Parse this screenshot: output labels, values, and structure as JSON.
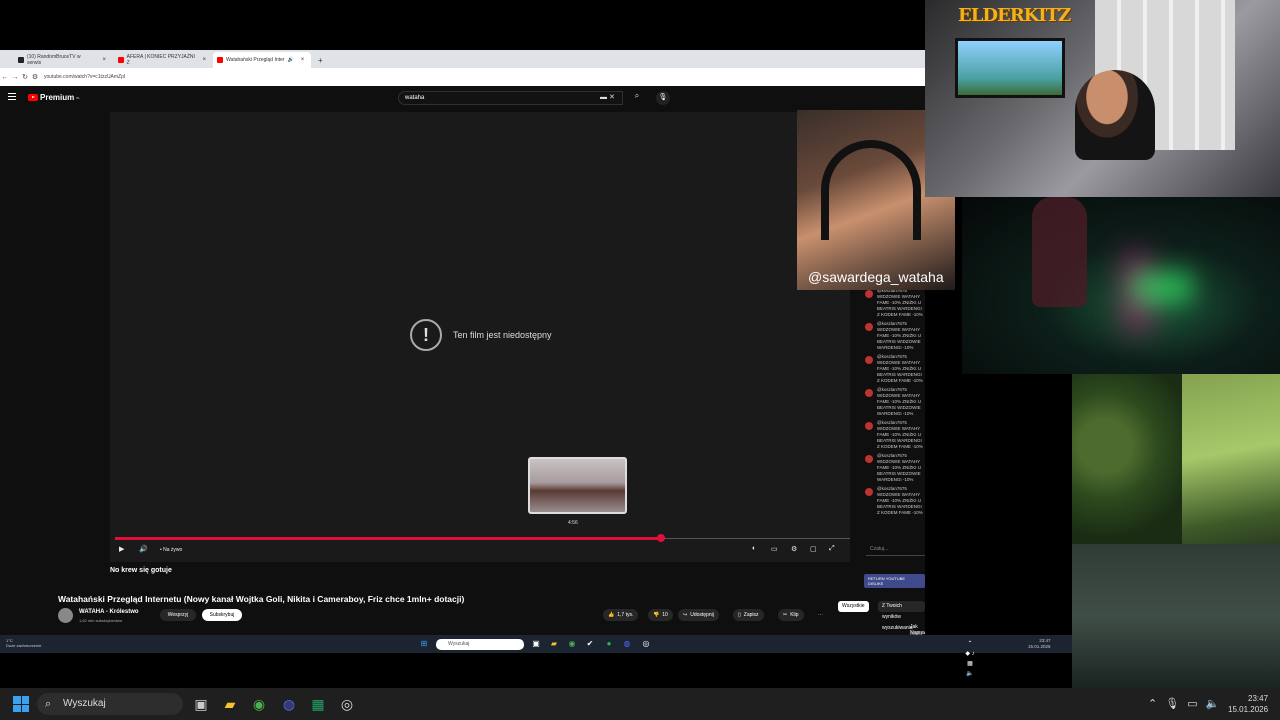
{
  "browser": {
    "tabs": [
      {
        "label": "(10) RandomBruceTV w serwis",
        "icon": "x-logo-icon",
        "color": "#222222"
      },
      {
        "label": "AFERA | KONIEC PRZYJAŹNI Z",
        "icon": "youtube-icon",
        "color": "#ff0000"
      },
      {
        "label": "Watahański Przegląd Inter",
        "icon": "youtube-icon",
        "color": "#ff0000",
        "active": true
      }
    ],
    "url": "youtube.com/watch?v=c1tzzUAmZpI"
  },
  "youtube": {
    "logo_text": "Premium",
    "logo_sup": "PL",
    "search_value": "wataha",
    "player": {
      "error_text": "Ten film jest niedostępny",
      "hover_time": "4:56",
      "live_label": "• Na żywo",
      "progress": 0.79
    },
    "live_title": "No krew się gotuje",
    "chat": {
      "messages": [
        "@koszlan7675 WIDZOWIE WATAHY FAME -10% ZNIŻKI U BEATRIS WARDENGI Z KODEM FAME -10%",
        "@koszlan7675 WIDZOWIE WATAHY FAME -10% ZNIŻKI U BEATRIS WIDZOWIE WARDENGI -10%",
        "@koszlan7675 WIDZOWIE WATAHY FAME -10% ZNIŻKI U BEATRIS WARDENGI Z KODEM FAME -10%",
        "@koszlan7675 WIDZOWIE WATAHY FAME -10% ZNIŻKI U BEATRIS WIDZOWIE WARDENGI -10%",
        "@koszlan7675 WIDZOWIE WATAHY FAME -10% ZNIŻKI U BEATRIS WARDENGI Z KODEM FAME -10%",
        "@koszlan7675 WIDZOWIE WATAHY FAME -10% ZNIŻKI U BEATRIS WIDZOWIE WARDENGI -10%",
        "@koszlan7675 WIDZOWIE WATAHY FAME -10% ZNIŻKI U BEATRIS WARDENGI Z KODEM FAME -10%"
      ],
      "input_placeholder": "Czatuj...",
      "return_button": "RETURN YOUTUBE DISLIKE"
    },
    "video": {
      "title": "Watahański Przegląd Internetu (Nowy kanał Wojtka Goli, Nikita i Cameraboy, Friz chce 1mln+ dotacji)",
      "channel": "WATAHA - Królestwo",
      "subscribers": "1,62 mln subskrybentów",
      "support_label": "Wesprzyj",
      "subscribe_label": "Subskrybuj",
      "likes": "1,7 tys.",
      "dislikes": "10",
      "share_label": "Udostępnij",
      "save_label": "Zapisz",
      "clip_label": "Klip",
      "more_label": "⋯"
    },
    "filter_chips": [
      "Wszystkie",
      "Z Twoich wyników wyszukiwania"
    ],
    "recommendation_title": "Jak Naprawdę Działa Polska",
    "recommendation_sub": "Mafia Sharestopowych"
  },
  "inner_taskbar": {
    "weather_temp": "1°C",
    "weather_desc": "Duże zachmurzenie",
    "search_placeholder": "Wyszukaj",
    "time": "23:47",
    "date": "15.01.2026"
  },
  "overlay": {
    "handle": "@sawardega_wataha",
    "logo": "ELDERKITZ"
  },
  "taskbar": {
    "search_placeholder": "Wyszukaj",
    "time": "23:47",
    "date": "15.01.2026"
  }
}
